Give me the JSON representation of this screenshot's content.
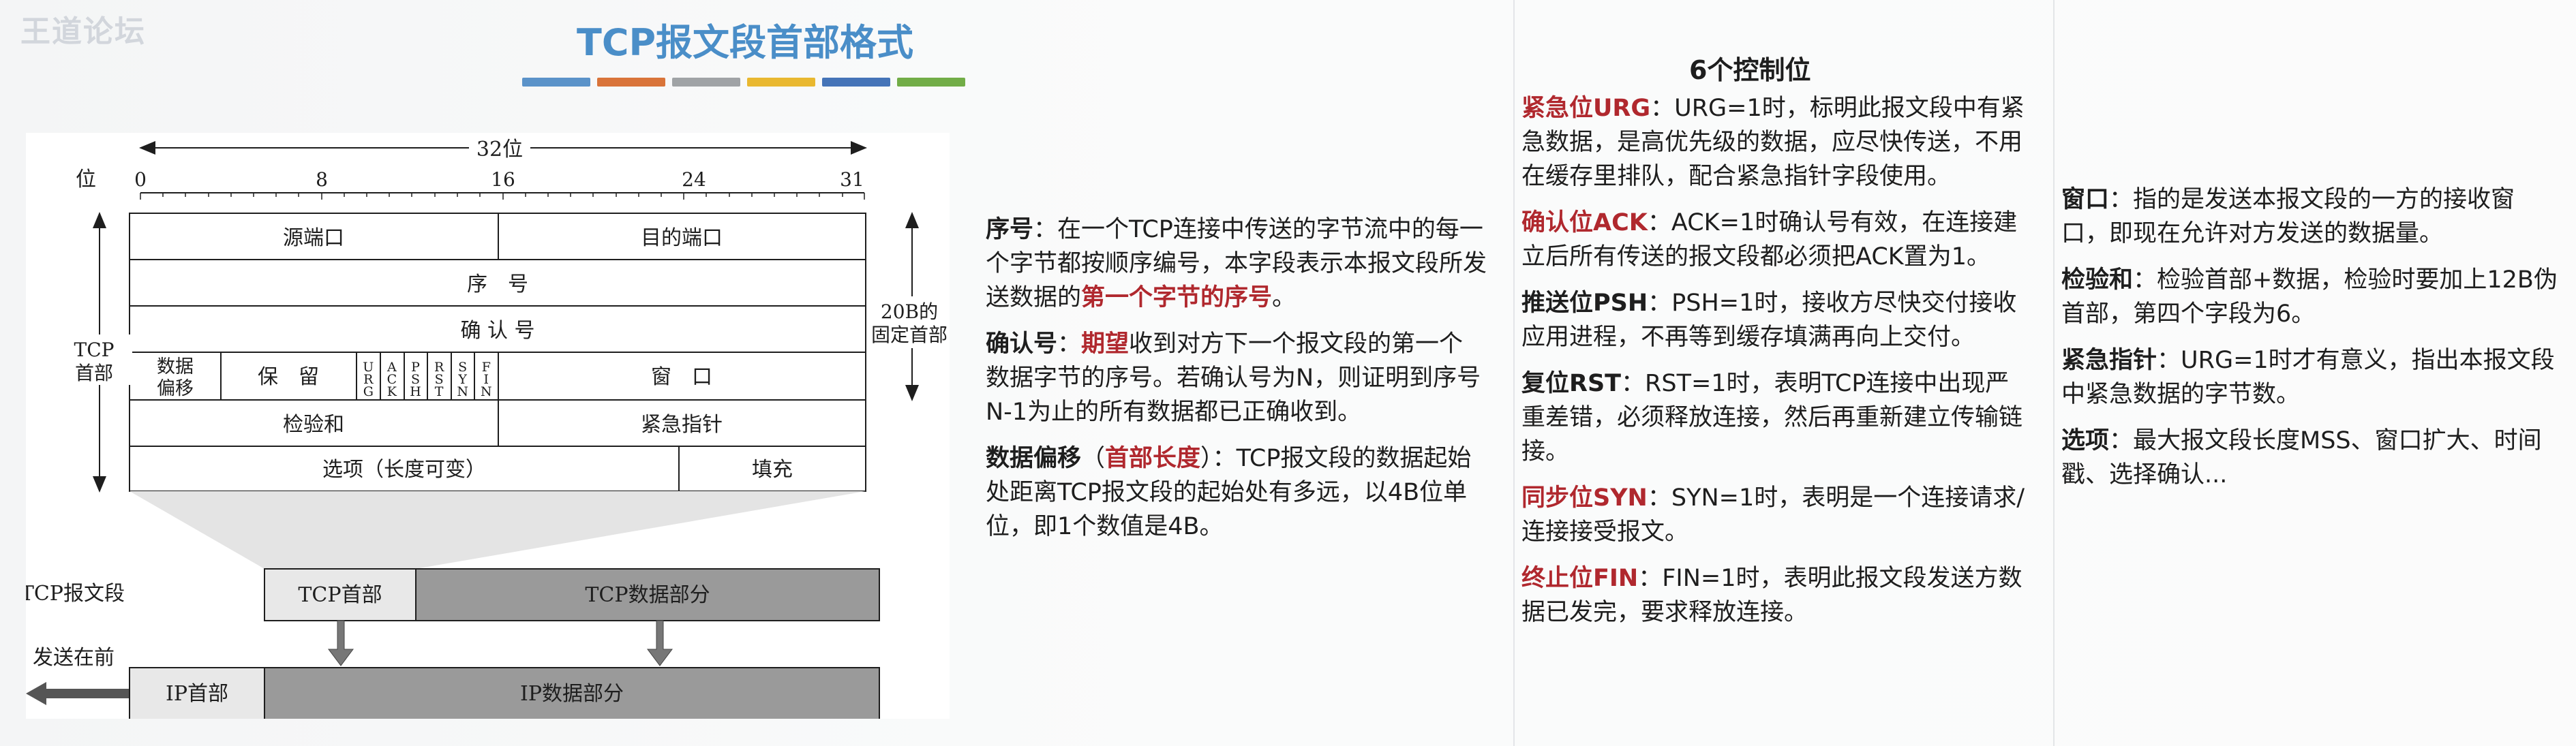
{
  "watermark": "王道论坛",
  "title": "TCP报文段首部格式",
  "title_bar_colors": [
    "#5b93c9",
    "#d9743a",
    "#a0a3a6",
    "#e9b830",
    "#4574b8",
    "#72ad47"
  ],
  "diagram": {
    "bits_label": "32位",
    "bit_axis_label": "位",
    "bit_ticks": [
      "0",
      "8",
      "16",
      "24",
      "31"
    ],
    "fields": {
      "src_port": "源端口",
      "dst_port": "目的端口",
      "seq": "序　号",
      "ack": "确 认 号",
      "data_offset_line1": "数据",
      "data_offset_line2": "偏移",
      "reserved": "保　留",
      "flags": [
        "URG",
        "ACK",
        "PSH",
        "RST",
        "SYN",
        "FIN"
      ],
      "window": "窗　口",
      "checksum": "检验和",
      "urgent_pointer": "紧急指针",
      "options": "选项（长度可变）",
      "padding": "填充"
    },
    "tcp_header_label_line1": "TCP",
    "tcp_header_label_line2": "首部",
    "fixed_header_line1": "20B的",
    "fixed_header_line2": "固定首部",
    "segment_label": "TCP报文段",
    "segment_header": "TCP首部",
    "segment_data": "TCP数据部分",
    "send_first": "发送在前",
    "ip_header": "IP首部",
    "ip_data": "IP数据部分"
  },
  "col1": {
    "seq_term": "序号",
    "seq_text_a": "：在一个TCP连接中传送的字节流中的每一个字节都按顺序编号，本字段表示本报文段所发送数据的",
    "seq_highlight": "第一个字节的序号",
    "seq_text_b": "。",
    "ack_term": "确认号",
    "ack_text_a": "：",
    "ack_highlight": "期望",
    "ack_text_b": "收到对方下一个报文段的第一个数据字节的序号。若确认号为N，则证明到序号N-1为止的所有数据都已正确收到。",
    "offset_term": "数据偏移",
    "offset_paren_open": "（",
    "offset_highlight": "首部长度",
    "offset_paren_close": "）",
    "offset_text": "：TCP报文段的数据起始处距离TCP报文段的起始处有多远，以4B位单位，即1个数值是4B。"
  },
  "col2": {
    "heading": "6个控制位",
    "urg_term": "紧急位URG",
    "urg_text": "：URG=1时，标明此报文段中有紧急数据，是高优先级的数据，应尽快传送，不用在缓存里排队，配合紧急指针字段使用。",
    "ack_term": "确认位ACK",
    "ack_text": "：ACK=1时确认号有效，在连接建立后所有传送的报文段都必须把ACK置为1。",
    "psh_term": "推送位PSH",
    "psh_text": "：PSH=1时，接收方尽快交付接收应用进程，不再等到缓存填满再向上交付。",
    "rst_term": "复位RST",
    "rst_text": "：RST=1时，表明TCP连接中出现严重差错，必须释放连接，然后再重新建立传输链接。",
    "syn_term": "同步位SYN",
    "syn_text": "：SYN=1时，表明是一个连接请求/连接接受报文。",
    "fin_term": "终止位FIN",
    "fin_text": "：FIN=1时，表明此报文段发送方数据已发完，要求释放连接。"
  },
  "col3": {
    "window_term": "窗口",
    "window_text": "：指的是发送本报文段的一方的接收窗口，即现在允许对方发送的数据量。",
    "checksum_term": "检验和",
    "checksum_text": "：检验首部+数据，检验时要加上12B伪首部，第四个字段为6。",
    "urgptr_term": "紧急指针",
    "urgptr_text": "：URG=1时才有意义，指出本报文段中紧急数据的字节数。",
    "options_term": "选项",
    "options_text": "：最大报文段长度MSS、窗口扩大、时间戳、选择确认..."
  }
}
